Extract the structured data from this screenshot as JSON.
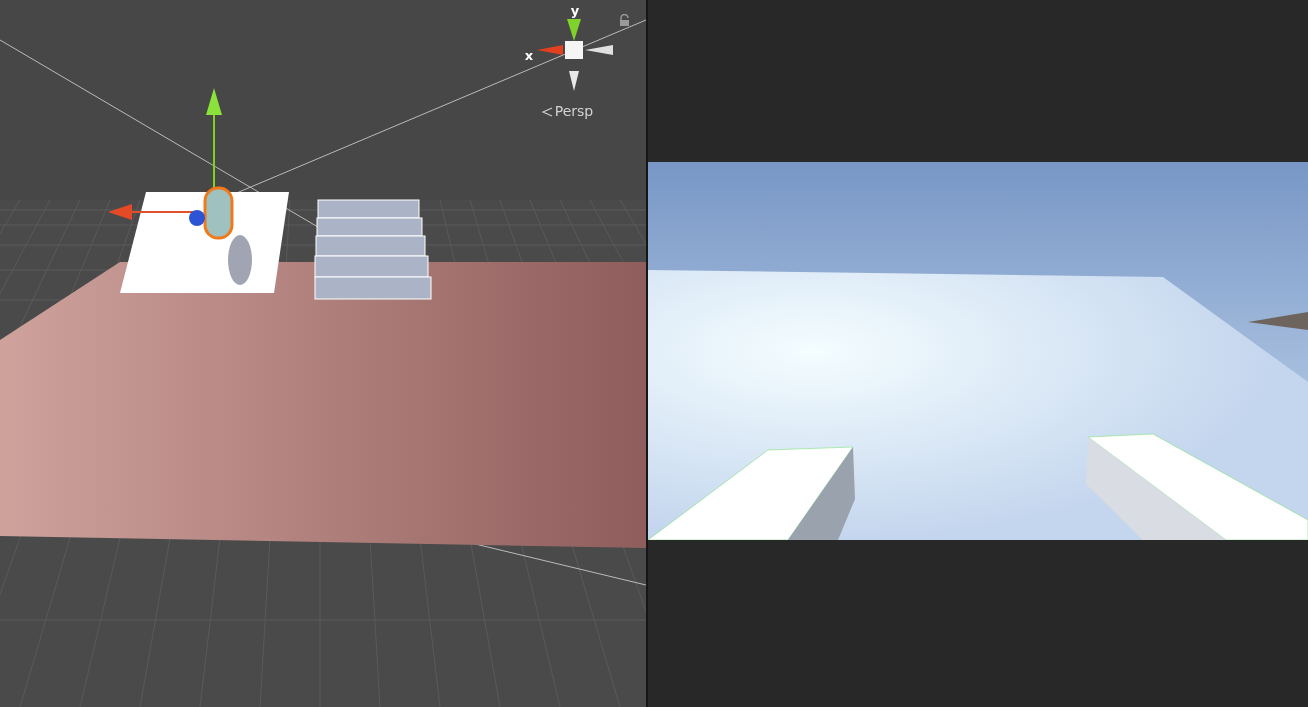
{
  "scene_view": {
    "gizmo": {
      "y_label": "y",
      "x_label": "x",
      "projection": "Persp"
    }
  }
}
